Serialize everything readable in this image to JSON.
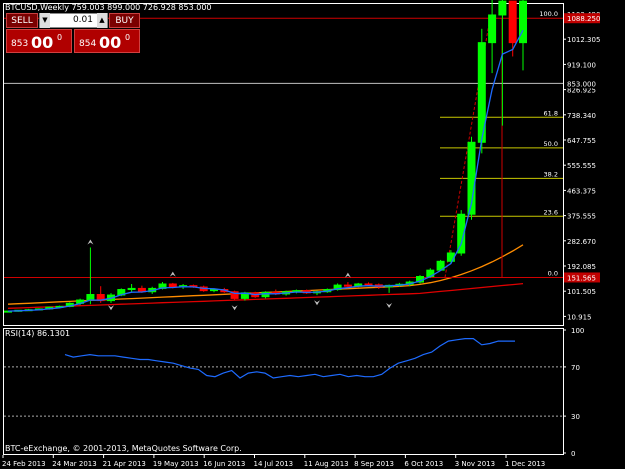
{
  "header": {
    "symbol_info": "BTCUSD,Weekly  759.003 899.000 726.928 853.000"
  },
  "trade_panel": {
    "sell_label": "SELL",
    "buy_label": "BUY",
    "lot_value": "0.01",
    "bid_small": "853",
    "bid_big": "00",
    "bid_sup": "0",
    "ask_small": "854",
    "ask_big": "00",
    "ask_sup": "0"
  },
  "price_axis": {
    "ticks": [
      "1103.490",
      "1012.305",
      "919.100",
      "826.925",
      "738.340",
      "647.755",
      "555.555",
      "463.375",
      "375.555",
      "282.670",
      "192.085",
      "101.505",
      "10.915"
    ],
    "current_price_label": "853.000",
    "fib_high_label": "1088.250",
    "fib_low_label": "151.565"
  },
  "fibonacci": {
    "levels": [
      "100.0",
      "61.8",
      "50.0",
      "38.2",
      "23.6",
      "0.0"
    ]
  },
  "rsi": {
    "label": "RSI(14) 86.1301",
    "ticks": [
      "100",
      "70",
      "30",
      "0"
    ],
    "values": [
      80,
      78,
      79,
      80,
      79,
      79,
      79,
      78,
      77,
      76,
      76,
      75,
      74,
      73,
      71,
      69,
      68,
      63,
      62,
      65,
      67,
      61,
      65,
      66,
      65,
      61,
      62,
      63,
      62,
      63,
      64,
      62,
      63,
      64,
      62,
      63,
      62,
      62,
      64,
      69,
      73,
      75,
      77,
      80,
      82,
      87,
      91,
      92,
      93,
      93,
      88,
      89,
      91,
      91,
      91
    ]
  },
  "footer": {
    "copyright": "BTC-eExchange, © 2001-2013, MetaQuotes Software Corp."
  },
  "time_axis": {
    "labels": [
      "24 Feb 2013",
      "24 Mar 2013",
      "21 Apr 2013",
      "19 May 2013",
      "16 Jun 2013",
      "14 Jul 2013",
      "11 Aug 2013",
      "8 Sep 2013",
      "6 Oct 2013",
      "3 Nov 2013",
      "1 Dec 2013"
    ]
  },
  "candles": [
    [
      27,
      31,
      25,
      30
    ],
    [
      30,
      34,
      28,
      33
    ],
    [
      33,
      38,
      32,
      35
    ],
    [
      35,
      40,
      33,
      38
    ],
    [
      38,
      46,
      35,
      44
    ],
    [
      44,
      50,
      40,
      47
    ],
    [
      47,
      62,
      44,
      58
    ],
    [
      58,
      75,
      52,
      70
    ],
    [
      70,
      260,
      55,
      90
    ],
    [
      90,
      120,
      60,
      68
    ],
    [
      68,
      95,
      60,
      88
    ],
    [
      88,
      112,
      84,
      108
    ],
    [
      108,
      128,
      100,
      112
    ],
    [
      112,
      122,
      96,
      100
    ],
    [
      100,
      118,
      92,
      112
    ],
    [
      112,
      135,
      108,
      128
    ],
    [
      128,
      132,
      112,
      118
    ],
    [
      118,
      128,
      110,
      122
    ],
    [
      122,
      126,
      114,
      117
    ],
    [
      117,
      122,
      100,
      104
    ],
    [
      104,
      112,
      98,
      108
    ],
    [
      108,
      114,
      96,
      100
    ],
    [
      100,
      104,
      70,
      76
    ],
    [
      76,
      100,
      68,
      96
    ],
    [
      96,
      100,
      78,
      82
    ],
    [
      82,
      102,
      76,
      98
    ],
    [
      98,
      108,
      88,
      92
    ],
    [
      92,
      104,
      86,
      100
    ],
    [
      100,
      108,
      94,
      104
    ],
    [
      104,
      108,
      92,
      96
    ],
    [
      96,
      104,
      88,
      100
    ],
    [
      100,
      112,
      96,
      108
    ],
    [
      108,
      130,
      104,
      124
    ],
    [
      124,
      135,
      112,
      120
    ],
    [
      120,
      132,
      116,
      128
    ],
    [
      128,
      134,
      120,
      125
    ],
    [
      125,
      130,
      110,
      118
    ],
    [
      118,
      126,
      96,
      123
    ],
    [
      123,
      132,
      118,
      127
    ],
    [
      127,
      140,
      120,
      135
    ],
    [
      135,
      160,
      130,
      155
    ],
    [
      155,
      185,
      150,
      178
    ],
    [
      178,
      215,
      175,
      210
    ],
    [
      210,
      250,
      200,
      240
    ],
    [
      240,
      395,
      230,
      380
    ],
    [
      380,
      660,
      360,
      640
    ],
    [
      640,
      1050,
      600,
      1000
    ],
    [
      1000,
      1242,
      890,
      1100
    ],
    [
      1100,
      1242,
      700,
      1150
    ],
    [
      1150,
      1150,
      950,
      1000
    ],
    [
      1000,
      1200,
      900,
      1150
    ]
  ],
  "colors": {
    "bull": "#00ff00",
    "bear": "#ff0000",
    "ma_fast": "#1e6bff",
    "ma_mid": "#ff8c00",
    "ma_slow": "#e00000",
    "fib": "#c8c800",
    "grid": "#ffffff"
  }
}
